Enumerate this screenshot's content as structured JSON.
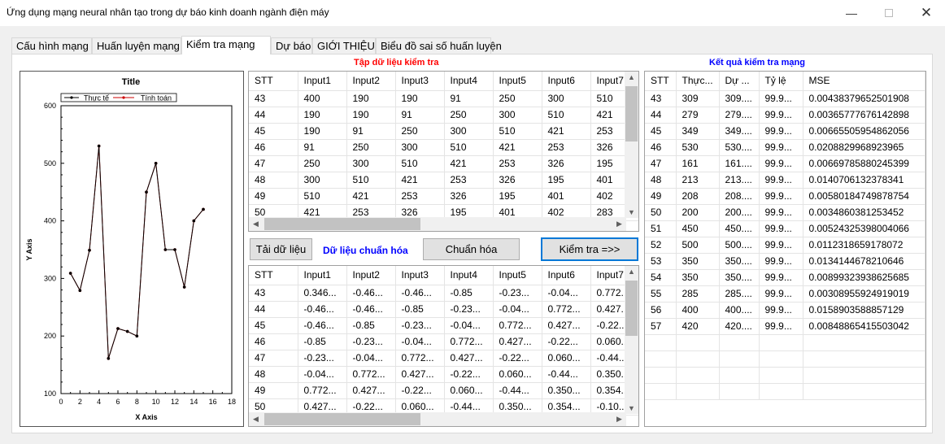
{
  "window": {
    "title": "Ứng dụng mạng neural nhân tạo trong dự báo kinh doanh ngành điện máy"
  },
  "tabs": [
    {
      "label": "Cấu hình mạng"
    },
    {
      "label": "Huấn luyện mạng"
    },
    {
      "label": "Kiểm tra mạng"
    },
    {
      "label": "Dự báo"
    },
    {
      "label": "GIỚI THIỆU"
    },
    {
      "label": "Biểu đồ sai số huấn luyện"
    }
  ],
  "colors": {
    "red_caption": "#ff0000",
    "blue_caption": "#0000ff",
    "focus_border": "#0078d7",
    "series_actual": "#000000",
    "series_calc": "#cc0000"
  },
  "chart_data": {
    "type": "line",
    "title": "Title",
    "xlabel": "X Axis",
    "ylabel": "Y Axis",
    "xlim": [
      0,
      18
    ],
    "ylim": [
      100,
      600
    ],
    "xticks": [
      "0",
      "2",
      "4",
      "6",
      "8",
      "10",
      "12",
      "14",
      "16",
      "18"
    ],
    "yticks": [
      "100",
      "200",
      "300",
      "400",
      "500",
      "600"
    ],
    "legend_position": "top",
    "series": [
      {
        "name": "Thực tế",
        "x": [
          1,
          2,
          3,
          4,
          5,
          6,
          7,
          8,
          9,
          10,
          11,
          12,
          13,
          14,
          15
        ],
        "values": [
          309,
          279,
          349,
          530,
          161,
          213,
          208,
          200,
          450,
          500,
          350,
          350,
          285,
          400,
          420
        ]
      },
      {
        "name": "Tính toán",
        "x": [
          1,
          2,
          3,
          4,
          5,
          6,
          7,
          8,
          9,
          10,
          11,
          12,
          13,
          14,
          15
        ],
        "values": [
          309,
          279,
          349,
          530,
          161,
          213,
          208,
          200,
          450,
          500,
          350,
          350,
          285,
          400,
          420
        ]
      }
    ]
  },
  "test_data": {
    "caption": "Tập dữ liệu kiểm tra",
    "headers": [
      "STT",
      "Input1",
      "Input2",
      "Input3",
      "Input4",
      "Input5",
      "Input6",
      "Input7"
    ],
    "rows": [
      [
        "43",
        "400",
        "190",
        "190",
        "91",
        "250",
        "300",
        "510"
      ],
      [
        "44",
        "190",
        "190",
        "91",
        "250",
        "300",
        "510",
        "421"
      ],
      [
        "45",
        "190",
        "91",
        "250",
        "300",
        "510",
        "421",
        "253"
      ],
      [
        "46",
        "91",
        "250",
        "300",
        "510",
        "421",
        "253",
        "326"
      ],
      [
        "47",
        "250",
        "300",
        "510",
        "421",
        "253",
        "326",
        "195"
      ],
      [
        "48",
        "300",
        "510",
        "421",
        "253",
        "326",
        "195",
        "401"
      ],
      [
        "49",
        "510",
        "421",
        "253",
        "326",
        "195",
        "401",
        "402"
      ],
      [
        "50",
        "421",
        "253",
        "326",
        "195",
        "401",
        "402",
        "283"
      ]
    ]
  },
  "buttons": {
    "load": "Tải dữ liệu",
    "normalized_label": "Dữ liệu chuẩn hóa",
    "normalize": "Chuẩn hóa",
    "test": "Kiểm tra =>>"
  },
  "norm_data": {
    "headers": [
      "STT",
      "Input1",
      "Input2",
      "Input3",
      "Input4",
      "Input5",
      "Input6",
      "Input7"
    ],
    "rows": [
      [
        "43",
        "0.346...",
        "-0.46...",
        "-0.46...",
        "-0.85",
        "-0.23...",
        "-0.04...",
        "0.772..."
      ],
      [
        "44",
        "-0.46...",
        "-0.46...",
        "-0.85",
        "-0.23...",
        "-0.04...",
        "0.772...",
        "0.427..."
      ],
      [
        "45",
        "-0.46...",
        "-0.85",
        "-0.23...",
        "-0.04...",
        "0.772...",
        "0.427...",
        "-0.22..."
      ],
      [
        "46",
        "-0.85",
        "-0.23...",
        "-0.04...",
        "0.772...",
        "0.427...",
        "-0.22...",
        "0.060..."
      ],
      [
        "47",
        "-0.23...",
        "-0.04...",
        "0.772...",
        "0.427...",
        "-0.22...",
        "0.060...",
        "-0.44..."
      ],
      [
        "48",
        "-0.04...",
        "0.772...",
        "0.427...",
        "-0.22...",
        "0.060...",
        "-0.44...",
        "0.350..."
      ],
      [
        "49",
        "0.772...",
        "0.427...",
        "-0.22...",
        "0.060...",
        "-0.44...",
        "0.350...",
        "0.354..."
      ],
      [
        "50",
        "0.427...",
        "-0.22...",
        "0.060...",
        "-0.44...",
        "0.350...",
        "0.354...",
        "-0.10..."
      ]
    ]
  },
  "results": {
    "caption": "Kết quả kiểm tra mạng",
    "headers": [
      "STT",
      "Thực...",
      "Dự ...",
      "Tỷ lệ",
      "MSE"
    ],
    "rows": [
      [
        "43",
        "309",
        "309....",
        "99.9...",
        "0.00438379652501908"
      ],
      [
        "44",
        "279",
        "279....",
        "99.9...",
        "0.00365777676142898"
      ],
      [
        "45",
        "349",
        "349....",
        "99.9...",
        "0.00665505954862056"
      ],
      [
        "46",
        "530",
        "530....",
        "99.9...",
        "0.0208829968923965"
      ],
      [
        "47",
        "161",
        "161....",
        "99.9...",
        "0.00669785880245399"
      ],
      [
        "48",
        "213",
        "213....",
        "99.9...",
        "0.0140706132378341"
      ],
      [
        "49",
        "208",
        "208....",
        "99.9...",
        "0.00580184749878754"
      ],
      [
        "50",
        "200",
        "200....",
        "99.9...",
        "0.0034860381253452"
      ],
      [
        "51",
        "450",
        "450....",
        "99.9...",
        "0.00524325398004066"
      ],
      [
        "52",
        "500",
        "500....",
        "99.9...",
        "0.0112318659178072"
      ],
      [
        "53",
        "350",
        "350....",
        "99.9...",
        "0.0134144678210646"
      ],
      [
        "54",
        "350",
        "350....",
        "99.9...",
        "0.00899323938625685"
      ],
      [
        "55",
        "285",
        "285....",
        "99.9...",
        "0.00308955924919019"
      ],
      [
        "56",
        "400",
        "400....",
        "99.9...",
        "0.0158903588857129"
      ],
      [
        "57",
        "420",
        "420....",
        "99.9...",
        "0.00848865415503042"
      ]
    ]
  }
}
